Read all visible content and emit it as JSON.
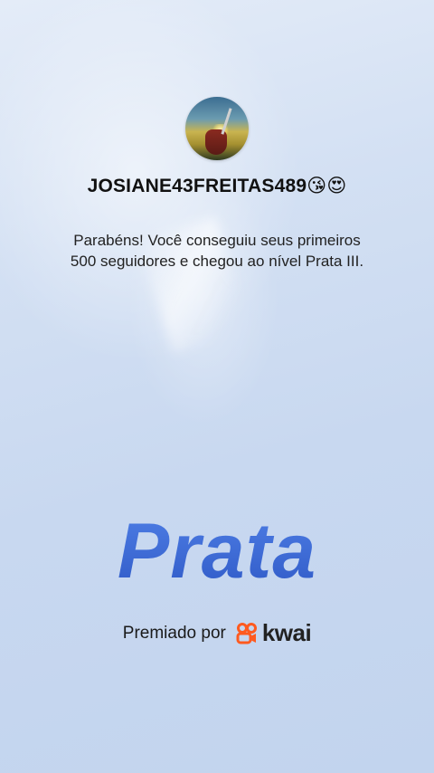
{
  "profile": {
    "username": "JOSIANE43FREITAS489",
    "emojis": "😘😍"
  },
  "message": {
    "line1": "Parabéns! Você conseguiu seus primeiros",
    "line2": "500 seguidores e chegou ao nível Prata III."
  },
  "level": {
    "title": "Prata"
  },
  "sponsor": {
    "label": "Premiado por",
    "brand": "kwai"
  },
  "colors": {
    "level_title": "#3d6ad8",
    "brand_orange": "#ff5a1f",
    "background": "#c8d8f0"
  },
  "icons": {
    "brand_mark": "kwai-logo-icon"
  }
}
